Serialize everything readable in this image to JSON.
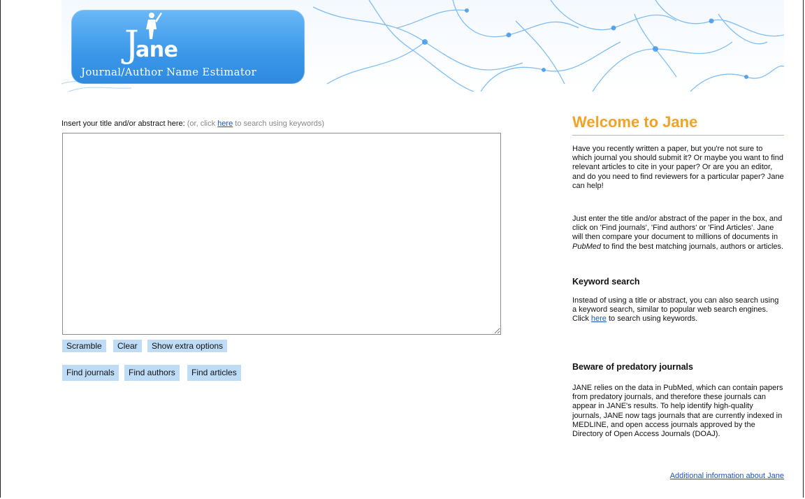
{
  "logo": {
    "J": "J",
    "ane": "ane",
    "subtitle": "Journal/Author Name Estimator"
  },
  "colors": {
    "accent_orange": "#f0a326",
    "button_blue": "#bfdcf6",
    "link_blue": "#1a55b5",
    "logo_blue": "#3a97e8"
  },
  "main": {
    "insert_label": "Insert your title and/or abstract here:",
    "hint_prefix": "(or, click",
    "hint_link": "here",
    "hint_suffix": "to search using keywords)",
    "textarea_value": "",
    "buttons_row1": [
      "Scramble",
      "Clear",
      "Show extra options"
    ],
    "buttons_row2": [
      "Find journals",
      "Find authors",
      "Find articles"
    ]
  },
  "sidebar": {
    "title": "Welcome to Jane",
    "intro": "Have you recently written a paper, but you're not sure to which journal you should submit it? Or maybe you want to find relevant articles to cite in your paper? Or are you an editor, and do you need to find reviewers for a particular paper? Jane can help!",
    "instructions_before": "Just enter the title and/or abstract of the paper in the box, and click on 'Find journals', 'Find authors' or 'Find Articles'. Jane will then compare your document to millions of documents in",
    "instructions_em": "PubMed",
    "instructions_after": "to find the best matching journals, authors or articles.",
    "keyword_heading": "Keyword search",
    "keyword_before": "Instead of using a title or abstract, you can also search using a keyword search, similar to popular web search engines. Click",
    "keyword_link": "here",
    "keyword_after": "to search using keywords.",
    "predatory_heading": "Beware of predatory journals",
    "predatory_text": "JANE relies on the data in PubMed, which can contain papers from predatory journals, and therefore these journals can appear in JANE's results. To help identify high-quality journals, JANE now tags journals that are currently indexed in MEDLINE, and open access journals approved by the Directory of Open Access Journals (DOAJ).",
    "more_link": "Additional information about Jane"
  }
}
